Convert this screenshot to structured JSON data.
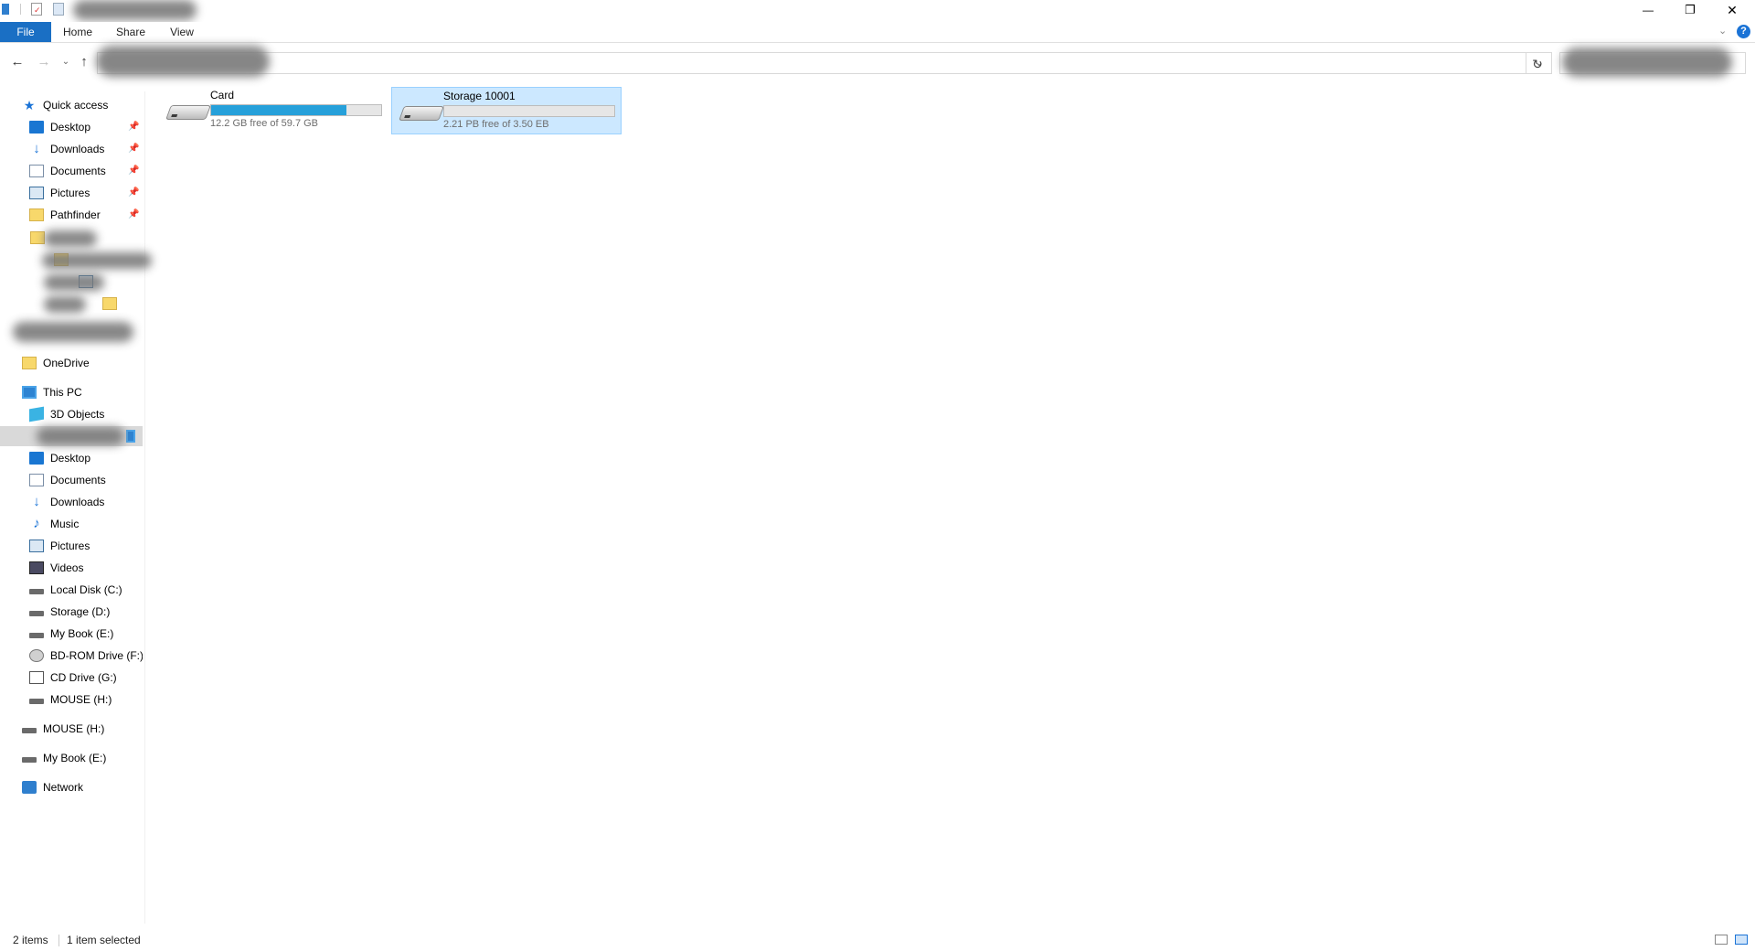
{
  "ribbon": {
    "tabs": [
      "File",
      "Home",
      "Share",
      "View"
    ]
  },
  "window": {
    "minimize": "—",
    "restore": "❐",
    "close": "✕"
  },
  "nav": {
    "quick_access": "Quick access",
    "quick_items": [
      {
        "label": "Desktop",
        "icon": "desktop-icon"
      },
      {
        "label": "Downloads",
        "icon": "download-icon"
      },
      {
        "label": "Documents",
        "icon": "documents-icon"
      },
      {
        "label": "Pictures",
        "icon": "pictures-icon"
      },
      {
        "label": "Pathfinder",
        "icon": "folder-icon"
      }
    ],
    "onedrive": "OneDrive",
    "this_pc": "This PC",
    "pc_items": [
      {
        "label": "3D Objects",
        "icon": "3d-objects-icon"
      },
      {
        "label": "Desktop",
        "icon": "desktop-icon"
      },
      {
        "label": "Documents",
        "icon": "documents-icon"
      },
      {
        "label": "Downloads",
        "icon": "download-icon"
      },
      {
        "label": "Music",
        "icon": "music-icon"
      },
      {
        "label": "Pictures",
        "icon": "pictures-icon"
      },
      {
        "label": "Videos",
        "icon": "videos-icon"
      },
      {
        "label": "Local Disk (C:)",
        "icon": "local-disk-icon"
      },
      {
        "label": "Storage (D:)",
        "icon": "drive-icon"
      },
      {
        "label": "My Book (E:)",
        "icon": "drive-icon"
      },
      {
        "label": "BD-ROM Drive (F:) A",
        "icon": "bd-rom-icon"
      },
      {
        "label": "CD Drive (G:)",
        "icon": "cd-drive-icon"
      },
      {
        "label": "MOUSE (H:)",
        "icon": "drive-icon"
      }
    ],
    "mouse": "MOUSE (H:)",
    "mybook": "My Book (E:)",
    "network": "Network"
  },
  "drives": [
    {
      "name": "Card",
      "free_text": "12.2 GB free of 59.7 GB",
      "used_fraction": 0.796
    },
    {
      "name": "Storage 10001",
      "free_text": "2.21 PB free of 3.50 EB",
      "used_fraction": 0.0
    }
  ],
  "status": {
    "items": "2 items",
    "selected": "1 item selected"
  },
  "colors": {
    "accent": "#1a6fc4",
    "selection": "#cce8ff",
    "bar_fill": "#26a0da"
  }
}
